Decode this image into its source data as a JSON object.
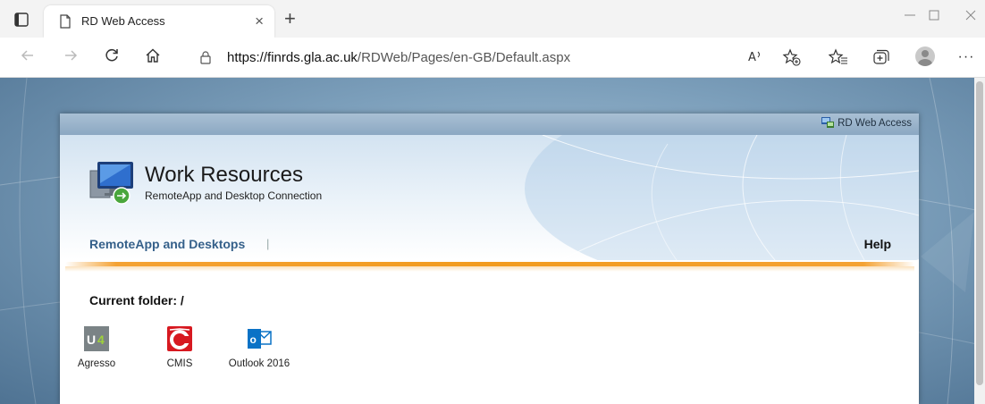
{
  "browser": {
    "tab_title": "RD Web Access",
    "tab_close": "×",
    "new_tab": "+",
    "url_host": "https://finrds.gla.ac.uk",
    "url_path": "/RDWeb/Pages/en-GB/Default.aspx",
    "more_label": "···"
  },
  "page": {
    "brand": "RD Web Access",
    "title": "Work Resources",
    "subtitle": "RemoteApp and Desktop Connection",
    "nav_link": "RemoteApp and Desktops",
    "nav_separator": "|",
    "help": "Help",
    "folder_label": "Current folder: /"
  },
  "apps": [
    {
      "label": "Agresso",
      "icon": "agresso-u4-icon",
      "color": "#7b8386"
    },
    {
      "label": "CMIS",
      "icon": "cmis-icon",
      "color": "#d71920"
    },
    {
      "label": "Outlook 2016",
      "icon": "outlook-icon",
      "color": "#0a72c6"
    }
  ],
  "colors": {
    "accent_orange": "#f29b1e",
    "link_blue": "#35608a"
  }
}
